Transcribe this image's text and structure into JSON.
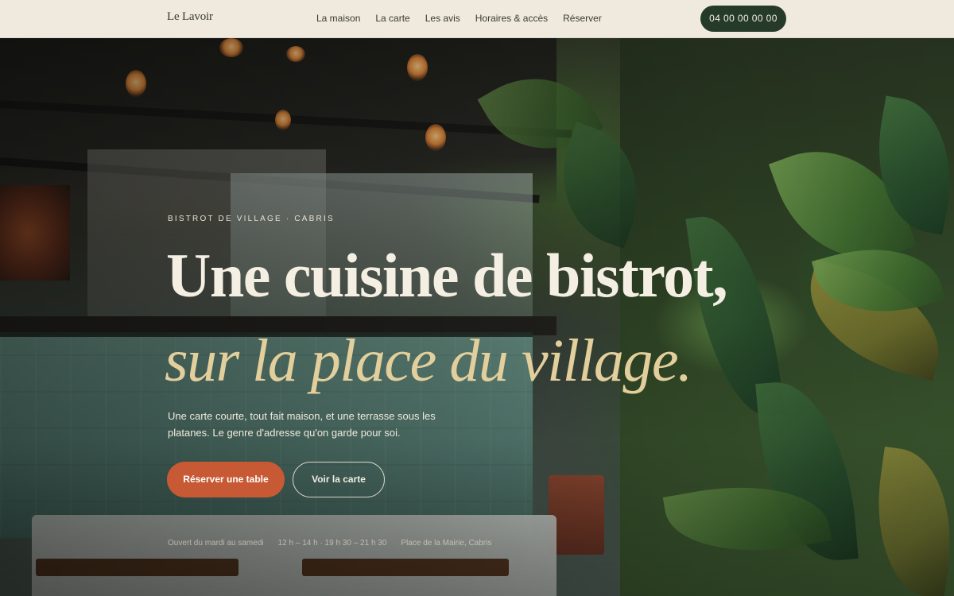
{
  "header": {
    "brand": "Le Lavoir",
    "nav": [
      "La maison",
      "La carte",
      "Les avis",
      "Horaires & accès",
      "Réserver"
    ],
    "phone": "04 00 00 00 00"
  },
  "hero": {
    "eyebrow": "Bistrot de village · Cabris",
    "headline_line1": "Une cuisine de bistrot,",
    "headline_line2": "sur la place du village.",
    "lead": "Une carte courte, tout fait maison, et une terrasse sous les platanes. Le genre d'adresse qu'on garde pour soi.",
    "primary_cta": "Réserver une table",
    "secondary_cta": "Voir la carte",
    "info": [
      "Ouvert du mardi au samedi",
      "12 h – 14 h · 19 h 30 – 21 h 30",
      "Place de la Mairie, Cabris"
    ]
  },
  "colors": {
    "header_bg": "#efeadd",
    "phone_button_bg": "#263a2a",
    "primary_cta_bg": "#c75a34",
    "headline_accent": "#e3cf9c"
  }
}
